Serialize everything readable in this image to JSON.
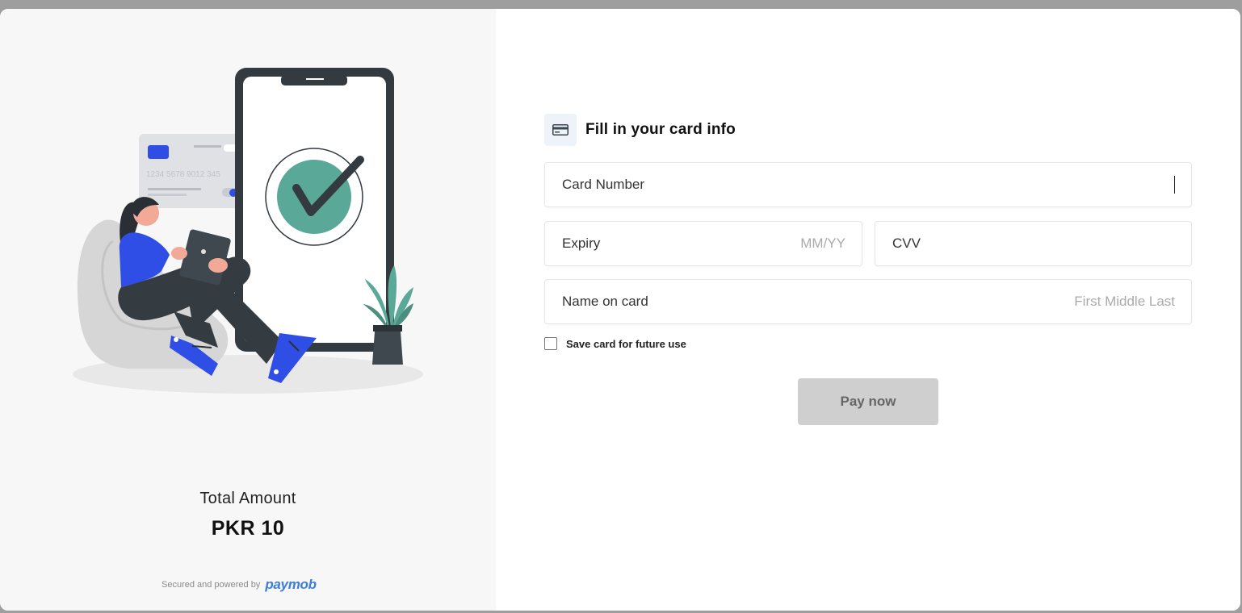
{
  "summary": {
    "total_label": "Total Amount",
    "total_value": "PKR 10",
    "powered_by": "Secured and powered by",
    "brand": "paymob"
  },
  "illustration": {
    "card_number_preview": "1234  5678  9012  345",
    "icon": "phone-checkmark-illustration"
  },
  "form": {
    "title": "Fill in your card info",
    "card_number_label": "Card Number",
    "expiry_label": "Expiry",
    "expiry_placeholder": "MM/YY",
    "cvv_label": "CVV",
    "name_label": "Name on card",
    "name_placeholder": "First Middle Last",
    "save_card_label": "Save card for future use",
    "save_card_checked": false,
    "pay_button": "Pay now"
  },
  "colors": {
    "accent_check": "#5aa897",
    "brand_blue": "#3b7fd8",
    "shoe_blue": "#2e4ee6",
    "button_disabled": "#cfcfcf"
  }
}
